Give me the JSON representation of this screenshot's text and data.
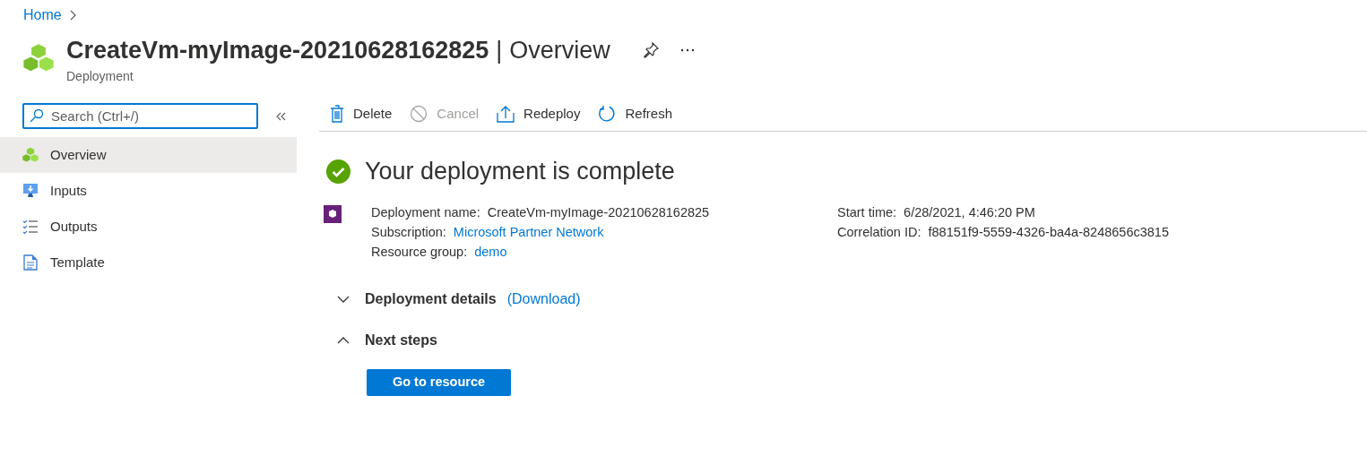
{
  "breadcrumb": {
    "items": [
      "Home"
    ]
  },
  "header": {
    "title": "CreateVm-myImage-20210628162825",
    "separator": "|",
    "section": "Overview",
    "subtitle": "Deployment"
  },
  "sidebar": {
    "search": {
      "placeholder": "Search (Ctrl+/)"
    },
    "items": [
      {
        "label": "Overview",
        "kind": "overview",
        "selected": true
      },
      {
        "label": "Inputs",
        "kind": "inputs",
        "selected": false
      },
      {
        "label": "Outputs",
        "kind": "outputs",
        "selected": false
      },
      {
        "label": "Template",
        "kind": "template",
        "selected": false
      }
    ]
  },
  "toolbar": [
    {
      "label": "Delete",
      "kind": "delete",
      "disabled": false
    },
    {
      "label": "Cancel",
      "kind": "cancel",
      "disabled": true
    },
    {
      "label": "Redeploy",
      "kind": "redeploy",
      "disabled": false
    },
    {
      "label": "Refresh",
      "kind": "refresh",
      "disabled": false
    }
  ],
  "status": {
    "title": "Your deployment is complete"
  },
  "properties_left": [
    {
      "label": "Deployment name:",
      "value": "CreateVm-myImage-20210628162825",
      "kind": "text"
    },
    {
      "label": "Subscription:",
      "value": "Microsoft Partner Network",
      "kind": "link"
    },
    {
      "label": "Resource group:",
      "value": "demo",
      "kind": "link"
    }
  ],
  "properties_right": [
    {
      "label": "Start time:",
      "value": "6/28/2021, 4:46:20 PM",
      "kind": "text"
    },
    {
      "label": "Correlation ID:",
      "value": "f88151f9-5559-4326-ba4a-8248656c3815",
      "kind": "text"
    }
  ],
  "sections": [
    {
      "title": "Deployment details",
      "link": "(Download)",
      "expanded": false
    },
    {
      "title": "Next steps",
      "expanded": true
    }
  ],
  "primary_button": "Go to resource"
}
